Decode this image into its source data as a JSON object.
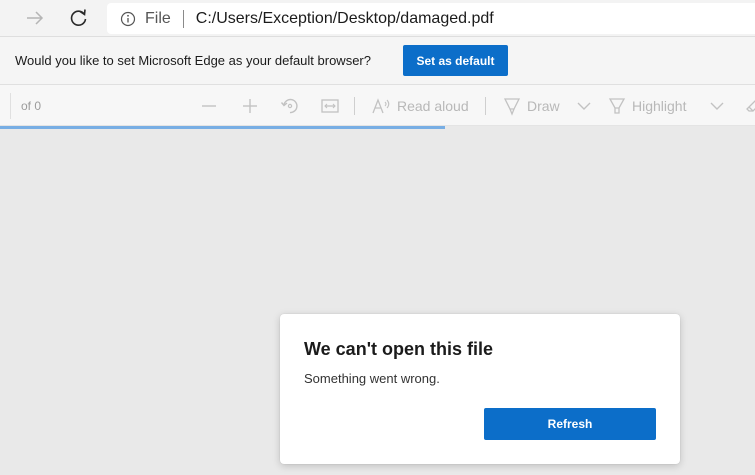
{
  "address_bar": {
    "scheme_label": "File",
    "url": "C:/Users/Exception/Desktop/damaged.pdf",
    "icons": [
      "forward-arrow-icon",
      "refresh-icon",
      "info-icon"
    ]
  },
  "infobar": {
    "message": "Would you like to set Microsoft Edge as your default browser?",
    "button_label": "Set as default",
    "accent_color": "#0c6ec9"
  },
  "pdf_toolbar": {
    "page_total": "of 0",
    "read_aloud_label": "Read aloud",
    "draw_label": "Draw",
    "highlight_label": "Highlight",
    "icons": [
      "zoom-out-icon",
      "zoom-in-icon",
      "rotate-icon",
      "fit-page-icon",
      "read-aloud-icon",
      "draw-pen-icon",
      "highlighter-icon",
      "eraser-icon",
      "chevron-down-icon"
    ]
  },
  "loading": {
    "progress": 0.59,
    "color": "#78aee4"
  },
  "dialog": {
    "title": "We can't open this file",
    "message": "Something went wrong.",
    "button_label": "Refresh"
  }
}
